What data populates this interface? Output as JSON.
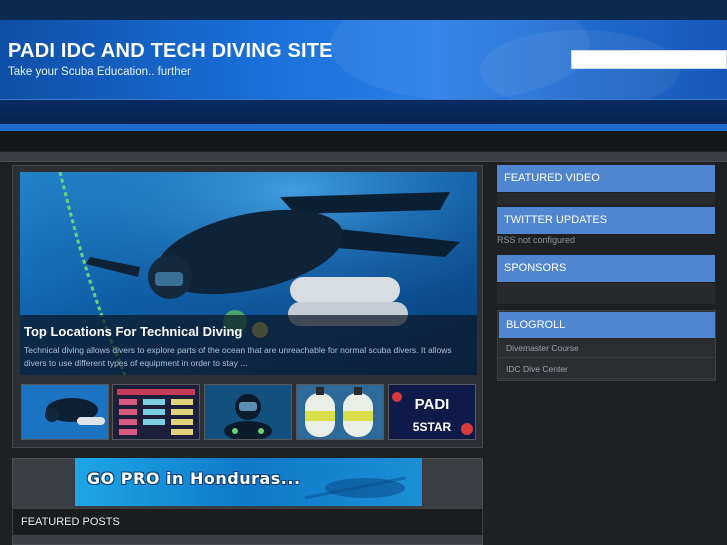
{
  "site": {
    "title": "PADI IDC AND TECH DIVING SITE",
    "tagline": "Take your Scuba Education.. further"
  },
  "search": {
    "value": "",
    "placeholder": ""
  },
  "slider": {
    "caption_title": "Top Locations For Technical Diving",
    "caption_text": "Technical diving allows divers to explore parts of the ocean that are unreachable for normal scuba divers. It allows divers to use different types of equipment in order to stay ...",
    "thumbnails": [
      {
        "icon": "diver-thumbnail"
      },
      {
        "icon": "table-chart-thumbnail"
      },
      {
        "icon": "diver-portrait-thumbnail"
      },
      {
        "icon": "scuba-tanks-thumbnail"
      },
      {
        "icon": "padi-5star-thumbnail",
        "brand_text": "PADI",
        "badge_text": "5STAR"
      }
    ]
  },
  "banner": {
    "text": "GO PRO in Honduras..."
  },
  "featured_posts": {
    "heading": "FEATURED POSTS"
  },
  "sidebar": {
    "featured_video": "FEATURED VIDEO",
    "twitter_updates": "TWITTER UPDATES",
    "rss_note": "RSS not configured",
    "sponsors": "SPONSORS",
    "blogroll": "BLOGROLL",
    "blog_links": [
      "Divemaster Course",
      "IDC Dive Center"
    ]
  },
  "colors": {
    "header_blue": "#1a6fd8",
    "widget_blue": "#4f86cf",
    "page_bg": "#1e2022"
  }
}
